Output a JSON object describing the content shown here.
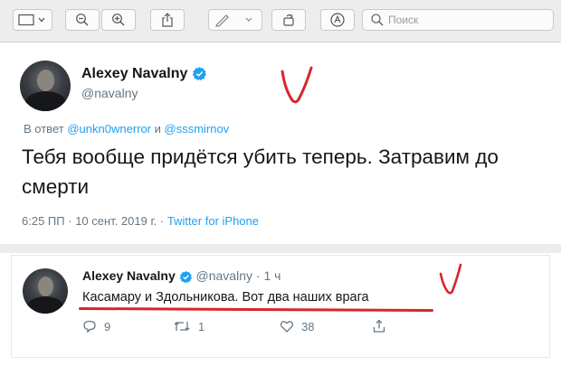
{
  "toolbar": {
    "search_placeholder": "Поиск",
    "icons": [
      "sidebar-toggle-icon",
      "zoom-out-icon",
      "zoom-in-icon",
      "share-icon",
      "markup-pen-icon",
      "rotate-icon",
      "markup-toolbar-icon",
      "search-icon"
    ]
  },
  "tweet": {
    "author_name": "Alexey Navalny",
    "handle": "@navalny",
    "reply_prefix": "В ответ",
    "mention_1": "@unkn0wnerror",
    "mention_join": "и",
    "mention_2": "@sssmirnov",
    "text": "Тебя вообще придётся убить теперь. Затравим до смерти",
    "time": "6:25 ПП",
    "date": "10 сент. 2019 г.",
    "separator": "·",
    "source": "Twitter for iPhone"
  },
  "tweet2": {
    "author_name": "Alexey Navalny",
    "handle": "@navalny",
    "separator": "·",
    "age": "1 ч",
    "text": "Касамару и Здольникова. Вот два наших врага",
    "replies": "9",
    "retweets": "1",
    "likes": "38"
  },
  "colors": {
    "accent": "#1da1f2",
    "annotation_red": "#d8262b",
    "muted_text": "#657786"
  }
}
